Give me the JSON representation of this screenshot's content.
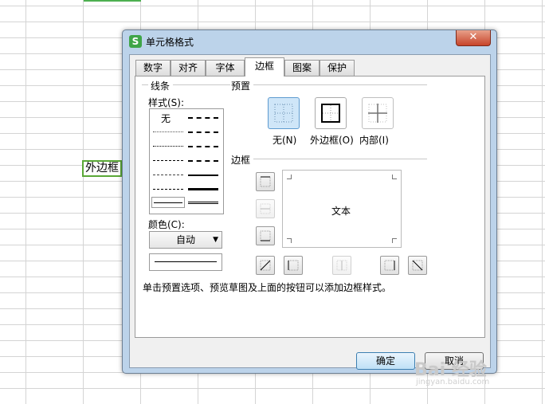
{
  "sheet": {
    "cell_text": "外边框"
  },
  "dialog": {
    "title": "单元格格式",
    "icon_letter": "S",
    "close_symbol": "✕",
    "tabs": [
      {
        "label": "数字"
      },
      {
        "label": "对齐"
      },
      {
        "label": "字体"
      },
      {
        "label": "边框"
      },
      {
        "label": "图案"
      },
      {
        "label": "保护"
      }
    ],
    "active_tab": "边框"
  },
  "line": {
    "group_label": "线条",
    "style_label": "样式(S):",
    "none_label": "无",
    "color_label": "颜色(C):",
    "color_value": "自动"
  },
  "presets": {
    "group_label": "预置",
    "items": [
      {
        "label": "无(N)"
      },
      {
        "label": "外边框(O)"
      },
      {
        "label": "内部(I)"
      }
    ]
  },
  "border": {
    "group_label": "边框",
    "preview_text": "文本"
  },
  "hint": "单击预置选项、预览草图及上面的按钮可以添加边框样式。",
  "buttons": {
    "ok": "确定",
    "cancel": "取消"
  },
  "watermark": {
    "main": "Bai 经验",
    "sub": "jingyan.baidu.com"
  },
  "colors": {
    "accent": "#5aa837",
    "titlebar": "#bcd3ea",
    "close": "#c7442a"
  }
}
